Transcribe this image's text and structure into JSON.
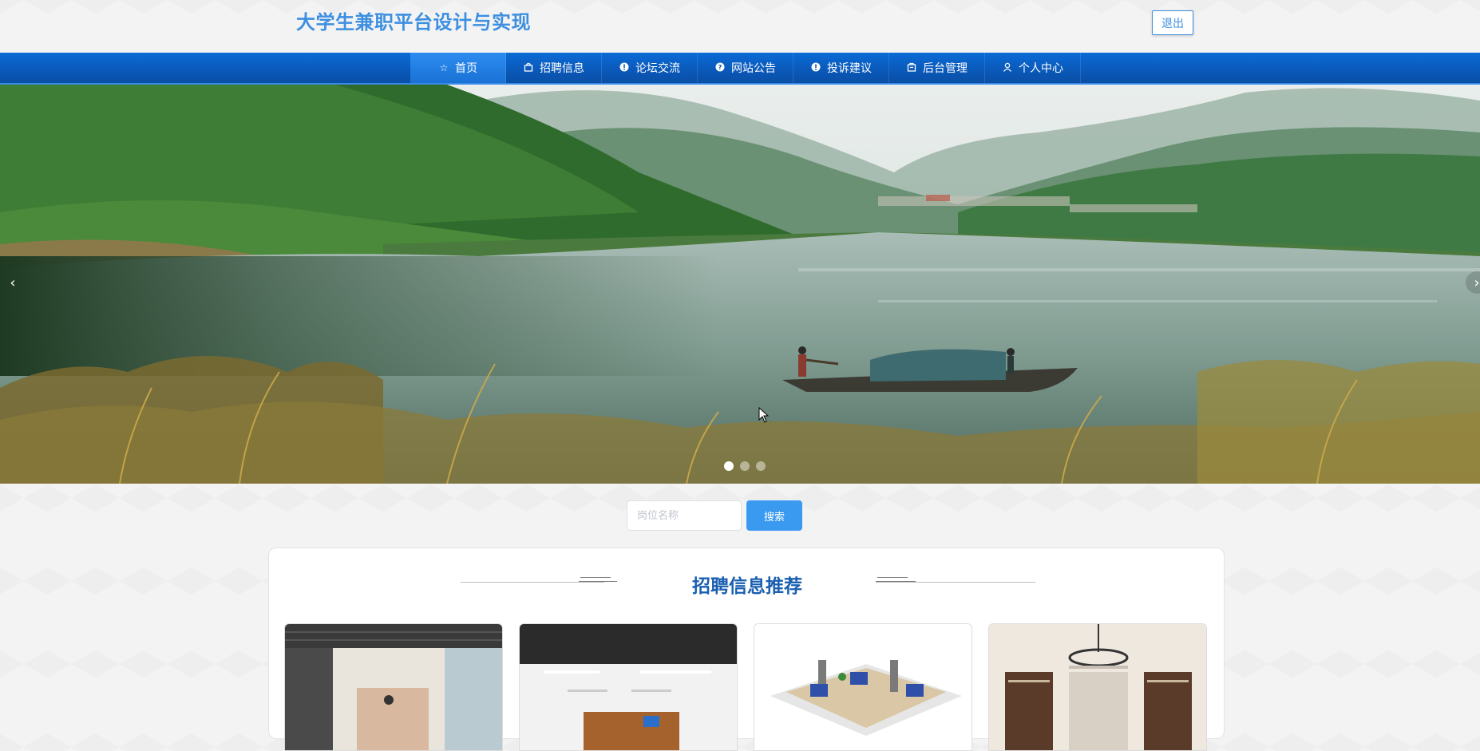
{
  "header": {
    "site_title": "大学生兼职平台设计与实现",
    "logout_label": "退出"
  },
  "nav": {
    "items": [
      {
        "label": "首页",
        "icon": "star-icon",
        "active": true
      },
      {
        "label": "招聘信息",
        "icon": "bag-icon"
      },
      {
        "label": "论坛交流",
        "icon": "info-icon"
      },
      {
        "label": "网站公告",
        "icon": "question-icon"
      },
      {
        "label": "投诉建议",
        "icon": "info-icon"
      },
      {
        "label": "后台管理",
        "icon": "box-icon"
      },
      {
        "label": "个人中心",
        "icon": "user-icon"
      }
    ]
  },
  "banner": {
    "slide_count": 3,
    "active_slide": 1
  },
  "search": {
    "placeholder": "岗位名称",
    "button_label": "搜索"
  },
  "recommend": {
    "title": "招聘信息推荐",
    "cards": [
      {
        "name": "office-loft"
      },
      {
        "name": "office-ceiling"
      },
      {
        "name": "office-workstations"
      },
      {
        "name": "office-lounge"
      }
    ]
  },
  "colors": {
    "accent": "#3d8fe0",
    "nav_bg": "#0a58b8",
    "title_blue": "#1a5fb0",
    "button_blue": "#3a9af0"
  }
}
